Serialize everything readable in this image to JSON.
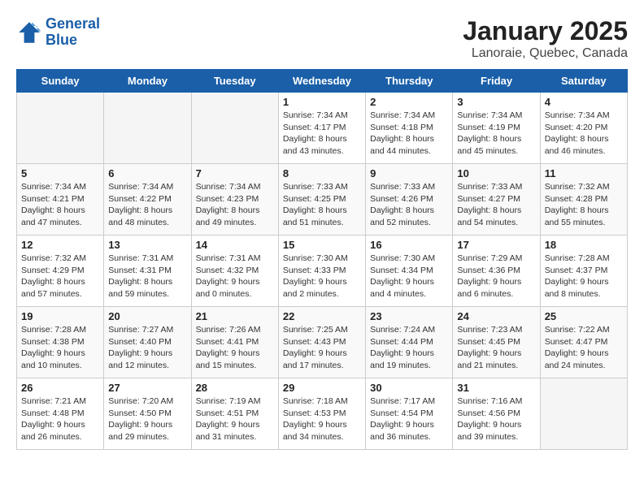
{
  "logo": {
    "line1": "General",
    "line2": "Blue"
  },
  "title": "January 2025",
  "subtitle": "Lanoraie, Quebec, Canada",
  "weekdays": [
    "Sunday",
    "Monday",
    "Tuesday",
    "Wednesday",
    "Thursday",
    "Friday",
    "Saturday"
  ],
  "weeks": [
    [
      {
        "day": "",
        "info": ""
      },
      {
        "day": "",
        "info": ""
      },
      {
        "day": "",
        "info": ""
      },
      {
        "day": "1",
        "info": "Sunrise: 7:34 AM\nSunset: 4:17 PM\nDaylight: 8 hours\nand 43 minutes."
      },
      {
        "day": "2",
        "info": "Sunrise: 7:34 AM\nSunset: 4:18 PM\nDaylight: 8 hours\nand 44 minutes."
      },
      {
        "day": "3",
        "info": "Sunrise: 7:34 AM\nSunset: 4:19 PM\nDaylight: 8 hours\nand 45 minutes."
      },
      {
        "day": "4",
        "info": "Sunrise: 7:34 AM\nSunset: 4:20 PM\nDaylight: 8 hours\nand 46 minutes."
      }
    ],
    [
      {
        "day": "5",
        "info": "Sunrise: 7:34 AM\nSunset: 4:21 PM\nDaylight: 8 hours\nand 47 minutes."
      },
      {
        "day": "6",
        "info": "Sunrise: 7:34 AM\nSunset: 4:22 PM\nDaylight: 8 hours\nand 48 minutes."
      },
      {
        "day": "7",
        "info": "Sunrise: 7:34 AM\nSunset: 4:23 PM\nDaylight: 8 hours\nand 49 minutes."
      },
      {
        "day": "8",
        "info": "Sunrise: 7:33 AM\nSunset: 4:25 PM\nDaylight: 8 hours\nand 51 minutes."
      },
      {
        "day": "9",
        "info": "Sunrise: 7:33 AM\nSunset: 4:26 PM\nDaylight: 8 hours\nand 52 minutes."
      },
      {
        "day": "10",
        "info": "Sunrise: 7:33 AM\nSunset: 4:27 PM\nDaylight: 8 hours\nand 54 minutes."
      },
      {
        "day": "11",
        "info": "Sunrise: 7:32 AM\nSunset: 4:28 PM\nDaylight: 8 hours\nand 55 minutes."
      }
    ],
    [
      {
        "day": "12",
        "info": "Sunrise: 7:32 AM\nSunset: 4:29 PM\nDaylight: 8 hours\nand 57 minutes."
      },
      {
        "day": "13",
        "info": "Sunrise: 7:31 AM\nSunset: 4:31 PM\nDaylight: 8 hours\nand 59 minutes."
      },
      {
        "day": "14",
        "info": "Sunrise: 7:31 AM\nSunset: 4:32 PM\nDaylight: 9 hours\nand 0 minutes."
      },
      {
        "day": "15",
        "info": "Sunrise: 7:30 AM\nSunset: 4:33 PM\nDaylight: 9 hours\nand 2 minutes."
      },
      {
        "day": "16",
        "info": "Sunrise: 7:30 AM\nSunset: 4:34 PM\nDaylight: 9 hours\nand 4 minutes."
      },
      {
        "day": "17",
        "info": "Sunrise: 7:29 AM\nSunset: 4:36 PM\nDaylight: 9 hours\nand 6 minutes."
      },
      {
        "day": "18",
        "info": "Sunrise: 7:28 AM\nSunset: 4:37 PM\nDaylight: 9 hours\nand 8 minutes."
      }
    ],
    [
      {
        "day": "19",
        "info": "Sunrise: 7:28 AM\nSunset: 4:38 PM\nDaylight: 9 hours\nand 10 minutes."
      },
      {
        "day": "20",
        "info": "Sunrise: 7:27 AM\nSunset: 4:40 PM\nDaylight: 9 hours\nand 12 minutes."
      },
      {
        "day": "21",
        "info": "Sunrise: 7:26 AM\nSunset: 4:41 PM\nDaylight: 9 hours\nand 15 minutes."
      },
      {
        "day": "22",
        "info": "Sunrise: 7:25 AM\nSunset: 4:43 PM\nDaylight: 9 hours\nand 17 minutes."
      },
      {
        "day": "23",
        "info": "Sunrise: 7:24 AM\nSunset: 4:44 PM\nDaylight: 9 hours\nand 19 minutes."
      },
      {
        "day": "24",
        "info": "Sunrise: 7:23 AM\nSunset: 4:45 PM\nDaylight: 9 hours\nand 21 minutes."
      },
      {
        "day": "25",
        "info": "Sunrise: 7:22 AM\nSunset: 4:47 PM\nDaylight: 9 hours\nand 24 minutes."
      }
    ],
    [
      {
        "day": "26",
        "info": "Sunrise: 7:21 AM\nSunset: 4:48 PM\nDaylight: 9 hours\nand 26 minutes."
      },
      {
        "day": "27",
        "info": "Sunrise: 7:20 AM\nSunset: 4:50 PM\nDaylight: 9 hours\nand 29 minutes."
      },
      {
        "day": "28",
        "info": "Sunrise: 7:19 AM\nSunset: 4:51 PM\nDaylight: 9 hours\nand 31 minutes."
      },
      {
        "day": "29",
        "info": "Sunrise: 7:18 AM\nSunset: 4:53 PM\nDaylight: 9 hours\nand 34 minutes."
      },
      {
        "day": "30",
        "info": "Sunrise: 7:17 AM\nSunset: 4:54 PM\nDaylight: 9 hours\nand 36 minutes."
      },
      {
        "day": "31",
        "info": "Sunrise: 7:16 AM\nSunset: 4:56 PM\nDaylight: 9 hours\nand 39 minutes."
      },
      {
        "day": "",
        "info": ""
      }
    ]
  ]
}
